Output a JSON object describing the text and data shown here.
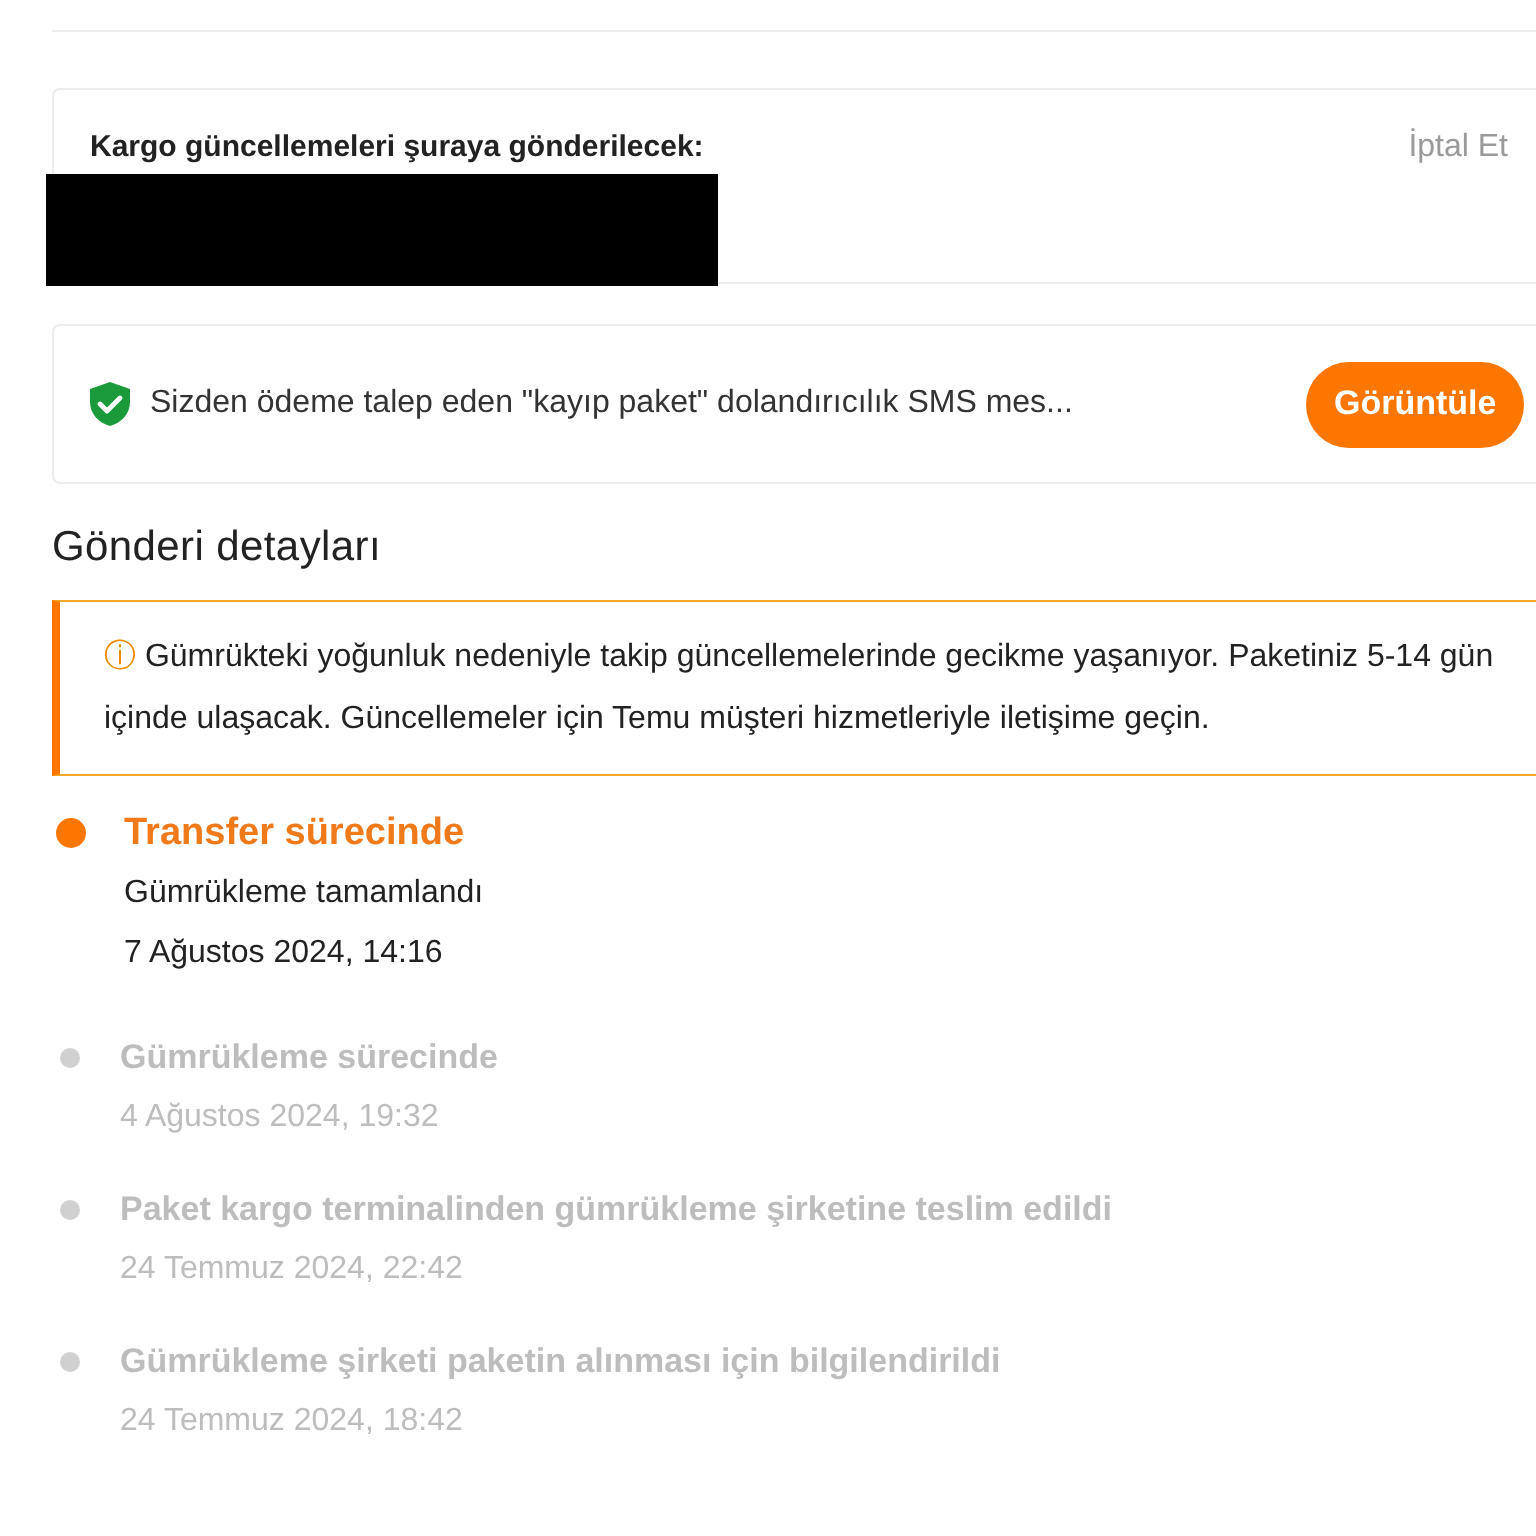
{
  "shipping_updates": {
    "label": "Kargo güncellemeleri şuraya gönderilecek:",
    "cancel": "İptal Et",
    "redacted": true
  },
  "alert": {
    "text": "Sizden ödeme talep eden \"kayıp paket\" dolandırıcılık SMS mes...",
    "button": "Görüntüle"
  },
  "section_title": "Gönderi detayları",
  "notice": {
    "icon": "ⓘ",
    "text": "Gümrükteki yoğunluk nedeniyle takip güncellemelerinde gecikme yaşanıyor. Paketiniz 5-14 gün içinde ulaşacak. Güncellemeler için Temu müşteri hizmetleriyle iletişime geçin."
  },
  "timeline": [
    {
      "title": "Transfer sürecinde",
      "detail": "Gümrükleme tamamlandı",
      "time": "7 Ağustos 2024, 14:16",
      "current": true
    },
    {
      "title": "Gümrükleme sürecinde",
      "time": "4 Ağustos 2024, 19:32",
      "current": false
    },
    {
      "title": "Paket kargo terminalinden gümrükleme şirketine teslim edildi",
      "time": "24 Temmuz 2024, 22:42",
      "current": false
    },
    {
      "title": "Gümrükleme şirketi paketin alınması için bilgilendirildi",
      "time": "24 Temmuz 2024, 18:42",
      "current": false
    }
  ]
}
